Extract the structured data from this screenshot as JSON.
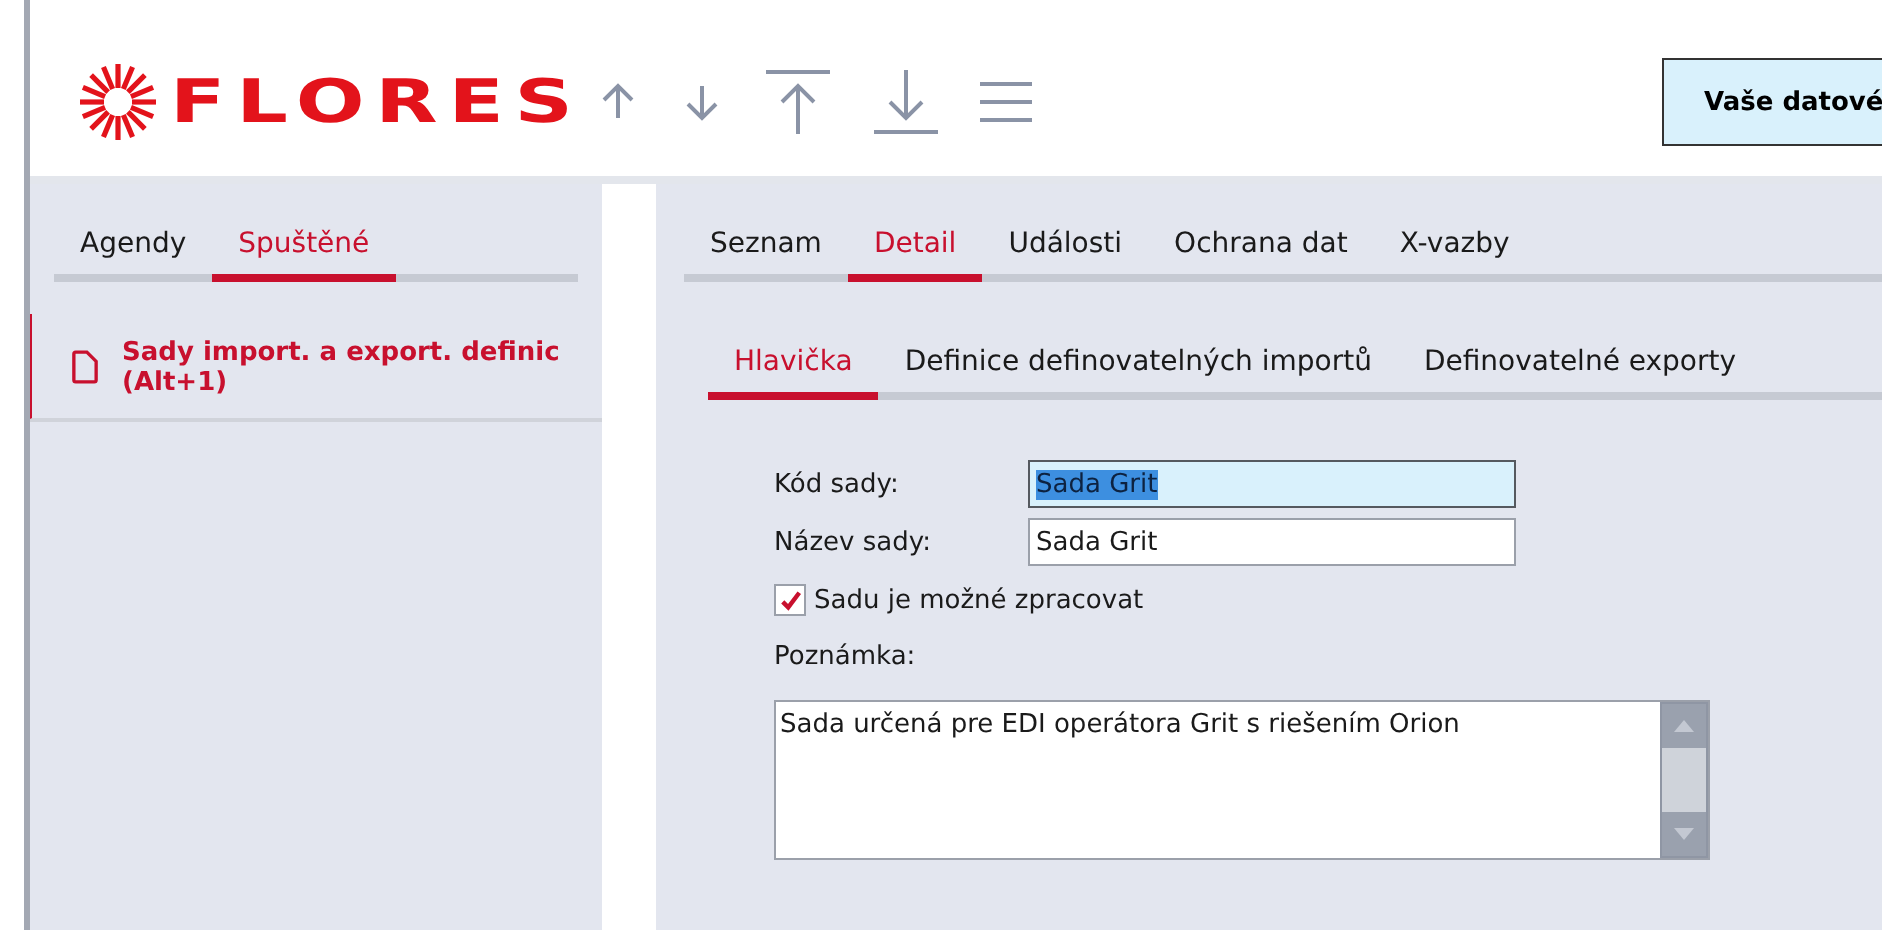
{
  "header": {
    "logo_text": "FLORES",
    "toolbar": [
      {
        "kind": "up"
      },
      {
        "kind": "down"
      },
      {
        "kind": "top"
      },
      {
        "kind": "bottom"
      },
      {
        "kind": "menu"
      }
    ],
    "data_button": "Vaše datové"
  },
  "sidebar": {
    "tabs": [
      {
        "label": "Agendy",
        "selected": false
      },
      {
        "label": "Spuštěné",
        "selected": true
      }
    ],
    "items": [
      {
        "label": "Sady import. a export. definic (Alt+1)",
        "selected": true
      }
    ]
  },
  "main": {
    "tabs": [
      {
        "label": "Seznam",
        "selected": false
      },
      {
        "label": "Detail",
        "selected": true
      },
      {
        "label": "Události",
        "selected": false
      },
      {
        "label": "Ochrana dat",
        "selected": false
      },
      {
        "label": "X-vazby",
        "selected": false
      }
    ],
    "subtabs": [
      {
        "label": "Hlavička",
        "selected": true
      },
      {
        "label": "Definice definovatelných importů",
        "selected": false
      },
      {
        "label": "Definovatelné exporty",
        "selected": false
      }
    ],
    "fields": [
      {
        "label": "Kód sady:",
        "value": "Sada Grit",
        "focused": true
      },
      {
        "label": "Název sady:",
        "value": "Sada Grit",
        "focused": false
      }
    ],
    "checkbox": {
      "label": "Sadu je možné zpracovat",
      "checked": true
    },
    "note": {
      "label": "Poznámka:",
      "value": "Sada určená pre EDI operátora Grit s riešením Orion"
    }
  }
}
